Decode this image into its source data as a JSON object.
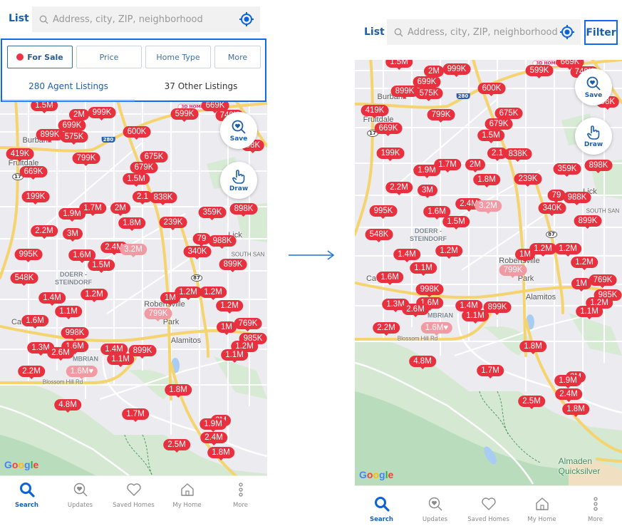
{
  "header": {
    "list_label": "List",
    "search_placeholder": "Address, city, ZIP, neighborhood",
    "filter_label": "Filter"
  },
  "filters": {
    "buttons": [
      {
        "label": "For Sale",
        "selected": true
      },
      {
        "label": "Price"
      },
      {
        "label": "Home Type"
      },
      {
        "label": "More"
      }
    ],
    "tabs": [
      {
        "label": "280 Agent Listings",
        "active": true
      },
      {
        "label": "37 Other Listings"
      }
    ]
  },
  "map_actions": {
    "save": "Save",
    "draw": "Draw"
  },
  "map": {
    "attribution": "Google",
    "badge_3d": "3D HOME",
    "pins": [
      {
        "price": "1.5M"
      },
      {
        "price": "2M"
      },
      {
        "price": "999K"
      },
      {
        "price": "699K"
      },
      {
        "price": "899K"
      },
      {
        "price": "575K"
      },
      {
        "price": "600K"
      },
      {
        "price": "599K"
      },
      {
        "price": "669K"
      },
      {
        "price": "749K"
      },
      {
        "price": "98K"
      },
      {
        "price": "419K"
      },
      {
        "price": "799K"
      },
      {
        "price": "675K"
      },
      {
        "price": "679K"
      },
      {
        "price": "669K"
      },
      {
        "price": "1.5M"
      },
      {
        "price": "199K"
      },
      {
        "price": "2.1"
      },
      {
        "price": "838K"
      },
      {
        "price": "1.9M"
      },
      {
        "price": "1.7M"
      },
      {
        "price": "2M"
      },
      {
        "price": "1.8M"
      },
      {
        "price": "239K"
      },
      {
        "price": "359K"
      },
      {
        "price": "898K"
      },
      {
        "price": "2.2M"
      },
      {
        "price": "3M"
      },
      {
        "price": "995K"
      },
      {
        "price": "2.4M"
      },
      {
        "price": "3.2M",
        "pale": true
      },
      {
        "price": "1.6M"
      },
      {
        "price": "1.5M"
      },
      {
        "price": "548K"
      },
      {
        "price": "79"
      },
      {
        "price": "988K"
      },
      {
        "price": "340K"
      },
      {
        "price": "899K"
      },
      {
        "price": "1.4M"
      },
      {
        "price": "1.2M"
      },
      {
        "price": "1M"
      },
      {
        "price": "1.2M"
      },
      {
        "price": "1.2M"
      },
      {
        "price": "1.1M"
      },
      {
        "price": "1.2M"
      },
      {
        "price": "799K",
        "pale": true
      },
      {
        "price": "1.6M"
      },
      {
        "price": "1M"
      },
      {
        "price": "769K"
      },
      {
        "price": "998K"
      },
      {
        "price": "985K"
      },
      {
        "price": "1.3M"
      },
      {
        "price": "1.6M"
      },
      {
        "price": "2.6M"
      },
      {
        "price": "1.4M"
      },
      {
        "price": "899K"
      },
      {
        "price": "1.2M"
      },
      {
        "price": "1.1M"
      },
      {
        "price": "1.1M"
      },
      {
        "price": "2.2M"
      },
      {
        "price": "1.6M♥",
        "pale": true
      },
      {
        "price": "4.8M"
      },
      {
        "price": "1.8M"
      },
      {
        "price": "1.7M"
      },
      {
        "price": "2M"
      },
      {
        "price": "1.9M"
      },
      {
        "price": "2.4M"
      },
      {
        "price": "2.5M"
      },
      {
        "price": "1.8M"
      }
    ],
    "places": [
      "Burbank",
      "Fruitdale",
      "Lick",
      "SOUTH SAN",
      "DOERR -\nSTEINDORF",
      "Robertsville",
      "Ca",
      "Park",
      "Alamitos",
      "MBRIAN",
      "Blossom Hill Rd",
      "Almaden\nQuicksilver"
    ],
    "shields": [
      "280",
      "17",
      "87"
    ]
  },
  "nav": [
    {
      "label": "Search",
      "icon": "search-icon",
      "active": true
    },
    {
      "label": "Updates",
      "icon": "updates-icon"
    },
    {
      "label": "Saved Homes",
      "icon": "heart-icon"
    },
    {
      "label": "My Home",
      "icon": "house-icon"
    },
    {
      "label": "More",
      "icon": "more-dots-icon"
    }
  ],
  "colors": {
    "accent": "#1268f0",
    "brand_blue": "#1c5ea8",
    "pin_red": "#e8313f",
    "pin_pale": "#f29aa3"
  }
}
